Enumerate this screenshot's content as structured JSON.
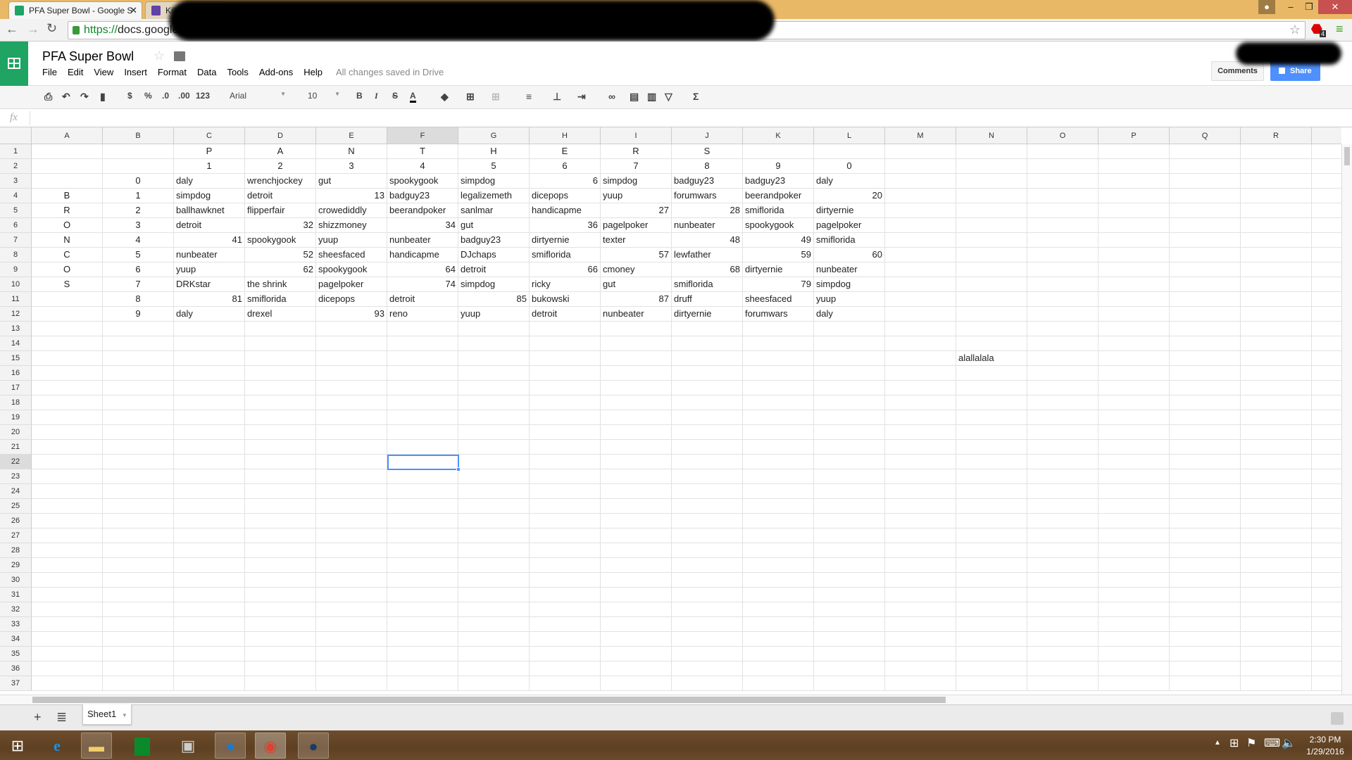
{
  "browser": {
    "tabs": [
      {
        "title": "PFA Super Bowl - Google S",
        "icon": "sheets-icon",
        "color": "#1fa463"
      },
      {
        "title": "Kill",
        "icon": "twitch-icon",
        "color": "#6441a5"
      }
    ],
    "url_secure": "https://",
    "url_host": "docs.google.com/",
    "extension_badge": "4"
  },
  "doc": {
    "title": "PFA Super Bowl",
    "menu": [
      "File",
      "Edit",
      "View",
      "Insert",
      "Format",
      "Data",
      "Tools",
      "Add-ons",
      "Help"
    ],
    "save_status": "All changes saved in Drive",
    "comments_label": "Comments",
    "share_label": "Share",
    "accent": "#4d90fe",
    "brand": "#1fa463"
  },
  "toolbar": {
    "currency": "$",
    "percent": "%",
    "dec_less": ".0",
    "dec_more": ".00",
    "format_more": "123",
    "font": "Arial",
    "font_size": "10",
    "bold": "B",
    "italic": "I",
    "strike": "S",
    "text_color": "A",
    "sum": "Σ"
  },
  "formula": {
    "fx_label": "fx",
    "value": ""
  },
  "grid": {
    "columns": [
      "A",
      "B",
      "C",
      "D",
      "E",
      "F",
      "G",
      "H",
      "I",
      "J",
      "K",
      "L",
      "M",
      "N",
      "O",
      "P",
      "Q",
      "R",
      "S"
    ],
    "row_count": 37,
    "selected_cell": "F22",
    "cells": {
      "1": [
        "",
        "",
        "P",
        "A",
        "N",
        "T",
        "H",
        "E",
        "R",
        "S",
        "",
        ""
      ],
      "2": [
        "",
        "",
        "1",
        "2",
        "3",
        "4",
        "5",
        "6",
        "7",
        "8",
        "9",
        "0"
      ],
      "3": [
        "",
        "0",
        "daly",
        "wrenchjockey",
        "gut",
        "spookygook",
        "simpdog",
        "6",
        "simpdog",
        "badguy23",
        "badguy23",
        "daly"
      ],
      "4": [
        "B",
        "1",
        "simpdog",
        "detroit",
        "13",
        "badguy23",
        "legalizemeth",
        "dicepops",
        "yuup",
        "forumwars",
        "beerandpoker",
        "20"
      ],
      "5": [
        "R",
        "2",
        "ballhawknet",
        "flipperfair",
        "crowediddly",
        "beerandpoker",
        "sanlmar",
        "handicapme",
        "27",
        "28",
        "smiflorida",
        "dirtyernie"
      ],
      "6": [
        "O",
        "3",
        "detroit",
        "32",
        "shizzmoney",
        "34",
        "gut",
        "36",
        "pagelpoker",
        "nunbeater",
        "spookygook",
        "pagelpoker"
      ],
      "7": [
        "N",
        "4",
        "41",
        "spookygook",
        "yuup",
        "nunbeater",
        "badguy23",
        "dirtyernie",
        "texter",
        "48",
        "49",
        "smiflorida"
      ],
      "8": [
        "C",
        "5",
        "nunbeater",
        "52",
        "sheesfaced",
        "handicapme",
        "DJchaps",
        "smiflorida",
        "57",
        "lewfather",
        "59",
        "60"
      ],
      "9": [
        "O",
        "6",
        "yuup",
        "62",
        "spookygook",
        "64",
        "detroit",
        "66",
        "cmoney",
        "68",
        "dirtyernie",
        "nunbeater"
      ],
      "10": [
        "S",
        "7",
        "DRKstar",
        "the shrink",
        "pagelpoker",
        "74",
        "simpdog",
        "ricky",
        "gut",
        "smiflorida",
        "79",
        "simpdog"
      ],
      "11": [
        "",
        "8",
        "81",
        "smiflorida",
        "dicepops",
        "detroit",
        "85",
        "bukowski",
        "87",
        "druff",
        "sheesfaced",
        "yuup"
      ],
      "12": [
        "",
        "9",
        "daly",
        "drexel",
        "93",
        "reno",
        "yuup",
        "detroit",
        "nunbeater",
        "dirtyernie",
        "forumwars",
        "daly"
      ],
      "15": [
        "",
        "",
        "",
        "",
        "",
        "",
        "",
        "",
        "",
        "",
        "",
        "",
        "",
        "alallalala"
      ]
    }
  },
  "sheets": {
    "tabs": [
      "Sheet1"
    ]
  },
  "taskbar": {
    "apps": [
      "windows-start-icon",
      "internet-explorer-icon",
      "file-explorer-icon",
      "store-icon",
      "resource-monitor-icon",
      "openoffice-icon",
      "chrome-icon",
      "steam-icon"
    ],
    "time": "2:30 PM",
    "date": "1/29/2016"
  }
}
